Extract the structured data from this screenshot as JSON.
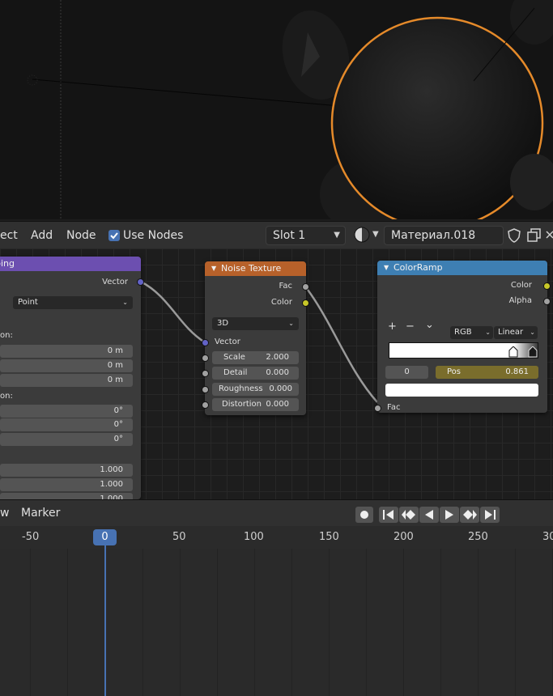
{
  "node_editor": {
    "menus": [
      "ect",
      "Add",
      "Node"
    ],
    "use_nodes_label": "Use Nodes",
    "slot": "Slot 1",
    "material_name": "Материал.018"
  },
  "mapping_node": {
    "title": "ping",
    "output_vector": "Vector",
    "type": "Point",
    "location_label": "on:",
    "location": [
      "0 m",
      "0 m",
      "0 m"
    ],
    "rotation_label": "on:",
    "rotation": [
      "0°",
      "0°",
      "0°"
    ],
    "scale": [
      "1.000",
      "1.000",
      "1.000"
    ]
  },
  "noise_node": {
    "title": "Noise Texture",
    "out_fac": "Fac",
    "out_color": "Color",
    "dimension": "3D",
    "in_vector": "Vector",
    "fields": [
      {
        "label": "Scale",
        "value": "2.000"
      },
      {
        "label": "Detail",
        "value": "0.000"
      },
      {
        "label": "Roughness",
        "value": "0.000"
      },
      {
        "label": "Distortion",
        "value": "0.000"
      }
    ]
  },
  "colorramp_node": {
    "title": "ColorRamp",
    "out_color": "Color",
    "out_alpha": "Alpha",
    "plus": "+",
    "minus": "−",
    "chevron": "⌄",
    "color_mode": "RGB",
    "interpolation": "Linear",
    "stop_index": "0",
    "pos_label": "Pos",
    "pos_value": "0.861",
    "in_fac": "Fac"
  },
  "timeline": {
    "menus": [
      "w",
      "Marker"
    ],
    "current_frame": "0",
    "ticks": [
      "-50",
      "50",
      "100",
      "150",
      "200",
      "250",
      "30"
    ]
  },
  "colors": {
    "noise_header": "#b7612a",
    "colorramp_header": "#3e7fb3",
    "mapping_header": "#6c4fb0",
    "selection_orange": "#e58a2a",
    "accent_blue": "#4772b3",
    "pos_field": "#7a6d2c"
  }
}
